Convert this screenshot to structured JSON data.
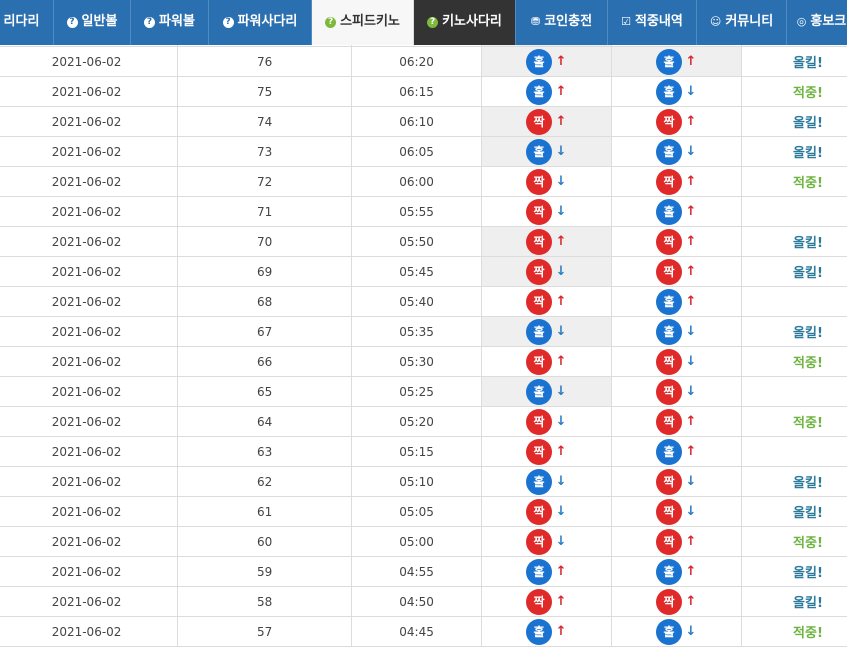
{
  "nav": {
    "tabs": [
      {
        "label": "리다리",
        "icon": ""
      },
      {
        "label": "일반볼",
        "icon": "help-icon"
      },
      {
        "label": "파워볼",
        "icon": "help-icon"
      },
      {
        "label": "파워사다리",
        "icon": "help-icon"
      },
      {
        "label": "스피드키노",
        "icon": "help-icon",
        "active": true
      },
      {
        "label": "키노사다리",
        "icon": "help-icon",
        "dark": true
      },
      {
        "label": "코인충전",
        "icon": "coin-icon"
      },
      {
        "label": "적중내역",
        "icon": "check-icon"
      },
      {
        "label": "커뮤니티",
        "icon": "smile-icon"
      },
      {
        "label": "홍보크",
        "icon": "promo-icon"
      }
    ]
  },
  "colors": {
    "odd": "#1a73d0",
    "even": "#e02a2a",
    "up": "#d8262d",
    "down": "#2a7bc4",
    "kill": "#2b7a9c",
    "hit": "#6cb33f"
  },
  "rows": [
    {
      "date": "2021-06-02",
      "round": "76",
      "time": "06:20",
      "a": "홀",
      "a_arrow": "up",
      "b": "홀",
      "b_arrow": "up",
      "result": "올킬!"
    },
    {
      "date": "2021-06-02",
      "round": "75",
      "time": "06:15",
      "a": "홀",
      "a_arrow": "up",
      "b": "홀",
      "b_arrow": "down",
      "result": "적중!"
    },
    {
      "date": "2021-06-02",
      "round": "74",
      "time": "06:10",
      "a": "짝",
      "a_arrow": "up",
      "b": "짝",
      "b_arrow": "up",
      "result": "올킬!"
    },
    {
      "date": "2021-06-02",
      "round": "73",
      "time": "06:05",
      "a": "홀",
      "a_arrow": "down",
      "b": "홀",
      "b_arrow": "down",
      "result": "올킬!"
    },
    {
      "date": "2021-06-02",
      "round": "72",
      "time": "06:00",
      "a": "짝",
      "a_arrow": "down",
      "b": "짝",
      "b_arrow": "up",
      "result": "적중!"
    },
    {
      "date": "2021-06-02",
      "round": "71",
      "time": "05:55",
      "a": "짝",
      "a_arrow": "down",
      "b": "홀",
      "b_arrow": "up",
      "result": ""
    },
    {
      "date": "2021-06-02",
      "round": "70",
      "time": "05:50",
      "a": "짝",
      "a_arrow": "up",
      "b": "짝",
      "b_arrow": "up",
      "result": "올킬!"
    },
    {
      "date": "2021-06-02",
      "round": "69",
      "time": "05:45",
      "a": "짝",
      "a_arrow": "down",
      "b": "짝",
      "b_arrow": "up",
      "result": "올킬!"
    },
    {
      "date": "2021-06-02",
      "round": "68",
      "time": "05:40",
      "a": "짝",
      "a_arrow": "up",
      "b": "홀",
      "b_arrow": "up",
      "result": ""
    },
    {
      "date": "2021-06-02",
      "round": "67",
      "time": "05:35",
      "a": "홀",
      "a_arrow": "down",
      "b": "홀",
      "b_arrow": "down",
      "result": "올킬!"
    },
    {
      "date": "2021-06-02",
      "round": "66",
      "time": "05:30",
      "a": "짝",
      "a_arrow": "up",
      "b": "짝",
      "b_arrow": "down",
      "result": "적중!"
    },
    {
      "date": "2021-06-02",
      "round": "65",
      "time": "05:25",
      "a": "홀",
      "a_arrow": "down",
      "b": "짝",
      "b_arrow": "down",
      "result": ""
    },
    {
      "date": "2021-06-02",
      "round": "64",
      "time": "05:20",
      "a": "짝",
      "a_arrow": "down",
      "b": "짝",
      "b_arrow": "up",
      "result": "적중!"
    },
    {
      "date": "2021-06-02",
      "round": "63",
      "time": "05:15",
      "a": "짝",
      "a_arrow": "up",
      "b": "홀",
      "b_arrow": "up",
      "result": ""
    },
    {
      "date": "2021-06-02",
      "round": "62",
      "time": "05:10",
      "a": "홀",
      "a_arrow": "down",
      "b": "짝",
      "b_arrow": "down",
      "result": "올킬!"
    },
    {
      "date": "2021-06-02",
      "round": "61",
      "time": "05:05",
      "a": "짝",
      "a_arrow": "down",
      "b": "짝",
      "b_arrow": "down",
      "result": "올킬!"
    },
    {
      "date": "2021-06-02",
      "round": "60",
      "time": "05:00",
      "a": "짝",
      "a_arrow": "down",
      "b": "짝",
      "b_arrow": "up",
      "result": "적중!"
    },
    {
      "date": "2021-06-02",
      "round": "59",
      "time": "04:55",
      "a": "홀",
      "a_arrow": "up",
      "b": "홀",
      "b_arrow": "up",
      "result": "올킬!"
    },
    {
      "date": "2021-06-02",
      "round": "58",
      "time": "04:50",
      "a": "짝",
      "a_arrow": "up",
      "b": "짝",
      "b_arrow": "up",
      "result": "올킬!"
    },
    {
      "date": "2021-06-02",
      "round": "57",
      "time": "04:45",
      "a": "홀",
      "a_arrow": "up",
      "b": "홀",
      "b_arrow": "down",
      "result": "적중!"
    }
  ]
}
